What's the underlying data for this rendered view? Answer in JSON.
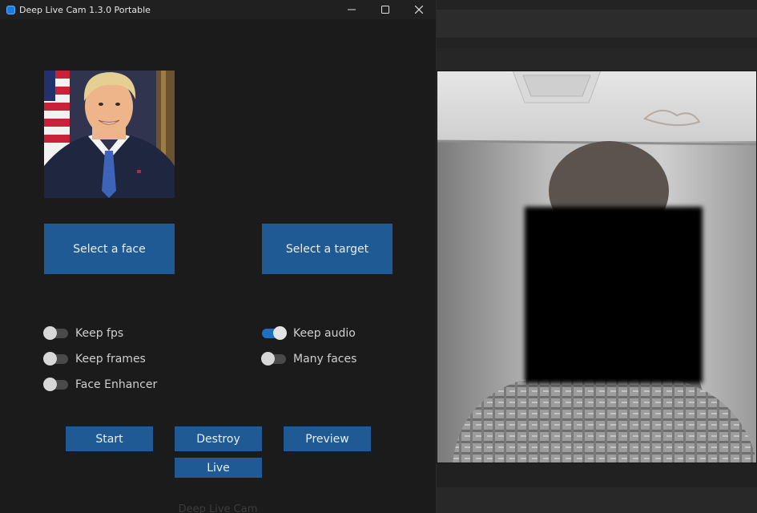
{
  "window": {
    "title": "Deep Live Cam 1.3.0 Portable"
  },
  "buttons": {
    "select_face": "Select a face",
    "select_target": "Select a target",
    "start": "Start",
    "destroy": "Destroy",
    "preview": "Preview",
    "live": "Live"
  },
  "options": {
    "keep_fps": {
      "label": "Keep fps",
      "on": false
    },
    "keep_frames": {
      "label": "Keep frames",
      "on": false
    },
    "face_enhancer": {
      "label": "Face Enhancer",
      "on": false
    },
    "keep_audio": {
      "label": "Keep audio",
      "on": true
    },
    "many_faces": {
      "label": "Many faces",
      "on": false
    }
  },
  "footer": {
    "text": "Deep Live Cam"
  },
  "icons": {
    "app": "app-icon",
    "minimize": "minimize-icon",
    "maximize": "maximize-icon",
    "close": "close-icon"
  },
  "colors": {
    "accent": "#1f5a94",
    "switch_on": "#1f6fc0",
    "background": "#1b1b1b"
  }
}
